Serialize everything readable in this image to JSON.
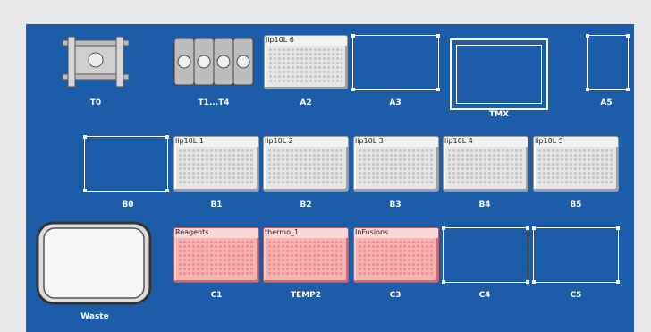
{
  "deck": {
    "row1": {
      "t0": "T0",
      "t1t4": "T1...T4",
      "a2": {
        "label": "A2",
        "plate": "lip10L 6"
      },
      "a3": "A3",
      "tmx": "TMX",
      "a5": "A5"
    },
    "row2": {
      "b0": "B0",
      "b1": {
        "label": "B1",
        "plate": "lip10L 1"
      },
      "b2": {
        "label": "B2",
        "plate": "lip10L 2"
      },
      "b3": {
        "label": "B3",
        "plate": "lip10L 3"
      },
      "b4": {
        "label": "B4",
        "plate": "lip10L 4"
      },
      "b5": {
        "label": "B5",
        "plate": "lip10L 5"
      }
    },
    "row3": {
      "waste": "Waste",
      "c1": {
        "label": "C1",
        "plate": "Reagents"
      },
      "temp2": {
        "label": "TEMP2",
        "plate": "thermo_1"
      },
      "c3": {
        "label": "C3",
        "plate": "InFusions"
      },
      "c4": "C4",
      "c5": "C5"
    }
  },
  "colors": {
    "deck": "#1c5ca8",
    "plate_gray": "#e6e6e6",
    "plate_red": "#f4b4b4"
  },
  "icons": {
    "t0": "tip-gripper-holder-icon",
    "t1t4": "tip-rack-holder-icon",
    "waste": "waste-container-icon"
  }
}
